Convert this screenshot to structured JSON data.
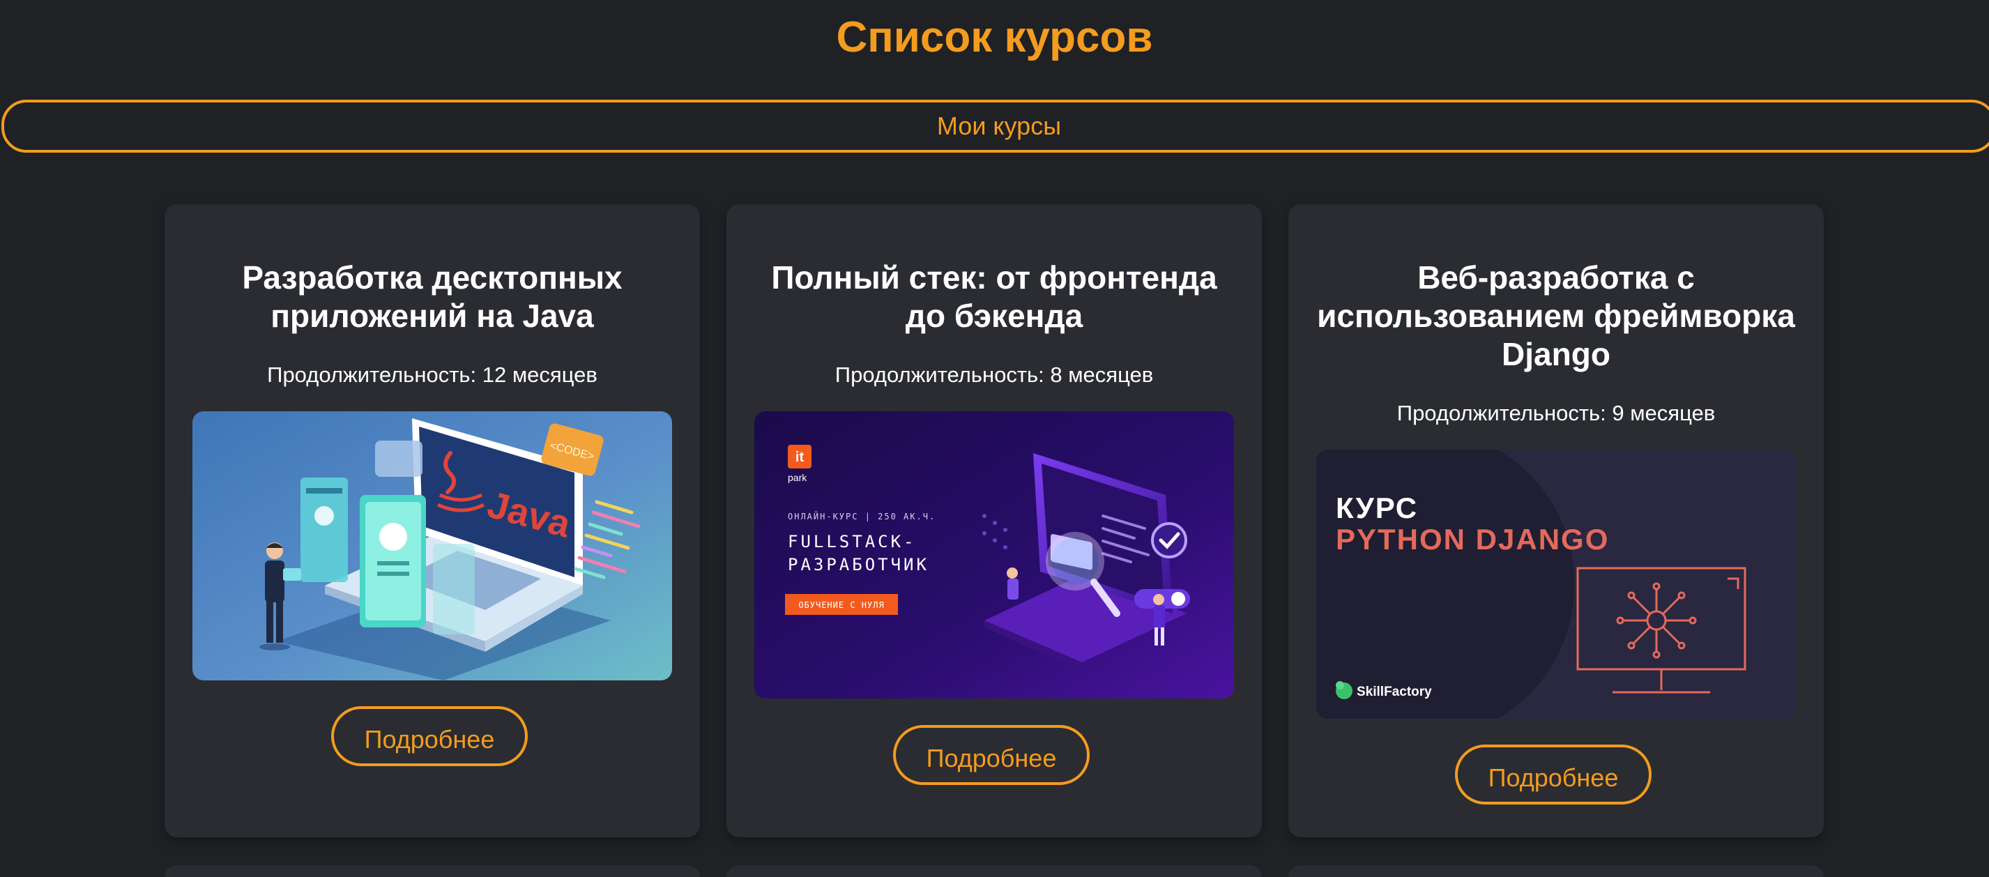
{
  "page": {
    "title": "Список курсов",
    "my_courses_label": "Мои курсы"
  },
  "courses": [
    {
      "title": "Разработка десктопных приложений на Java",
      "duration": "Продолжительность: 12 месяцев",
      "button_label": "Подробнее",
      "image": {
        "logo_text": "Java",
        "tag_text": "<CODE>"
      }
    },
    {
      "title": "Полный стек: от фронтенда до бэкенда",
      "duration": "Продолжительность: 8 месяцев",
      "button_label": "Подробнее",
      "image": {
        "brand_top": "it",
        "brand_bottom": "park",
        "meta": "ОНЛАЙН-КУРС | 250 АК.Ч.",
        "line1": "FULLSTACK-",
        "line2": "РАЗРАБОТЧИК",
        "badge": "ОБУЧЕНИЕ С НУЛЯ"
      }
    },
    {
      "title": "Веб-разработка с использованием фреймворка Django",
      "duration": "Продолжительность: 9 месяцев",
      "button_label": "Подробнее",
      "image": {
        "line1": "КУРС",
        "line2": "PYTHON DJANGO",
        "brand": "SkillFactory"
      }
    }
  ],
  "colors": {
    "background": "#1f2125",
    "card": "#2a2c31",
    "accent": "#f39c1e",
    "text": "#ffffff"
  }
}
